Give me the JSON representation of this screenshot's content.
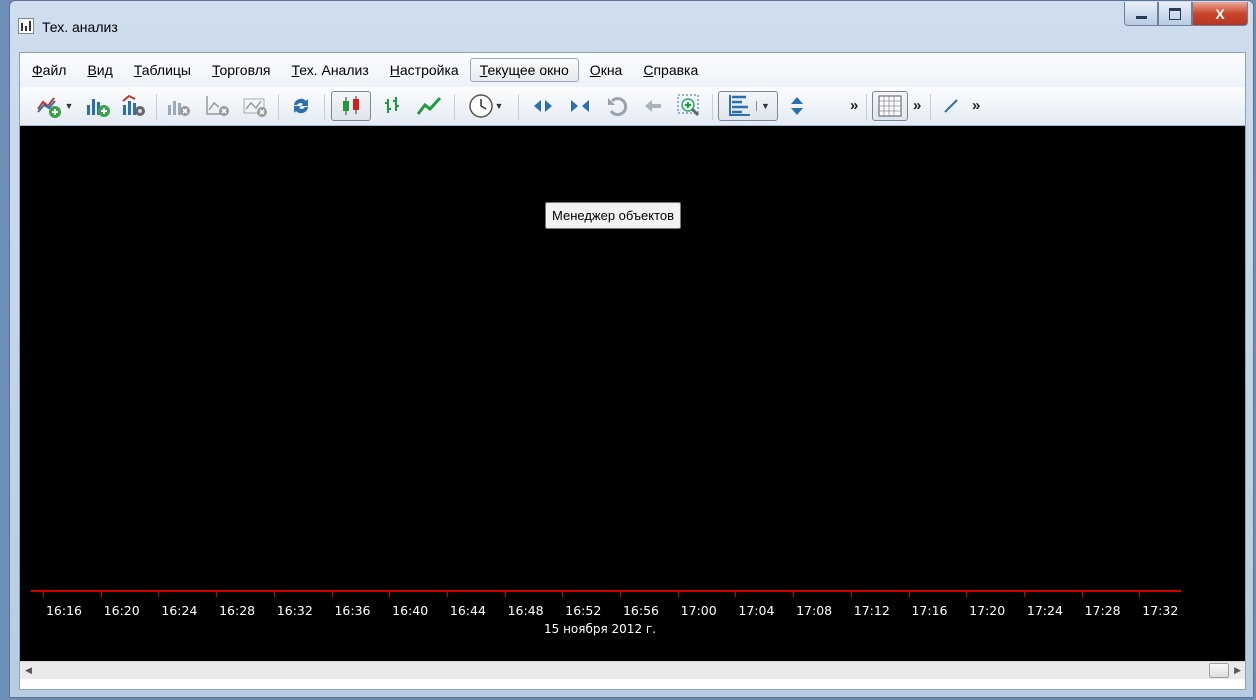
{
  "window": {
    "title": "Тех. анализ",
    "close_label": "X"
  },
  "menu": {
    "items": [
      {
        "label": "Файл",
        "active": false
      },
      {
        "label": "Вид",
        "active": false
      },
      {
        "label": "Таблицы",
        "active": false
      },
      {
        "label": "Торговля",
        "active": false
      },
      {
        "label": "Тех. Анализ",
        "active": false
      },
      {
        "label": "Настройка",
        "active": false
      },
      {
        "label": "Текущее окно",
        "active": true
      },
      {
        "label": "Окна",
        "active": false
      },
      {
        "label": "Справка",
        "active": false
      }
    ]
  },
  "toolbar": {
    "icons": [
      "add-chart-icon",
      "add-bar-chart-icon",
      "chart-settings-icon",
      "remove-chart-icon",
      "remove-line-icon",
      "remove-indicator-icon",
      "refresh-icon",
      "candlestick-icon",
      "bars-icon",
      "line-chart-icon",
      "clock-icon",
      "expand-icon",
      "collapse-icon",
      "undo-icon",
      "arrow-left-icon",
      "zoom-area-icon",
      "scale-icon",
      "updown-icon",
      "grid-icon",
      "draw-line-icon"
    ],
    "more_glyph": "»"
  },
  "tooltip": {
    "text": "Менеджер объектов"
  },
  "time_axis": {
    "labels": [
      "16:16",
      "16:20",
      "16:24",
      "16:28",
      "16:32",
      "16:36",
      "16:40",
      "16:44",
      "16:48",
      "16:52",
      "16:56",
      "17:00",
      "17:04",
      "17:08",
      "17:12",
      "17:16",
      "17:20",
      "17:24",
      "17:28",
      "17:32"
    ],
    "date": "15 ноября 2012 г."
  },
  "colors": {
    "chart_bg": "#000000",
    "axis": "#d40000",
    "text": "#ffffff"
  }
}
